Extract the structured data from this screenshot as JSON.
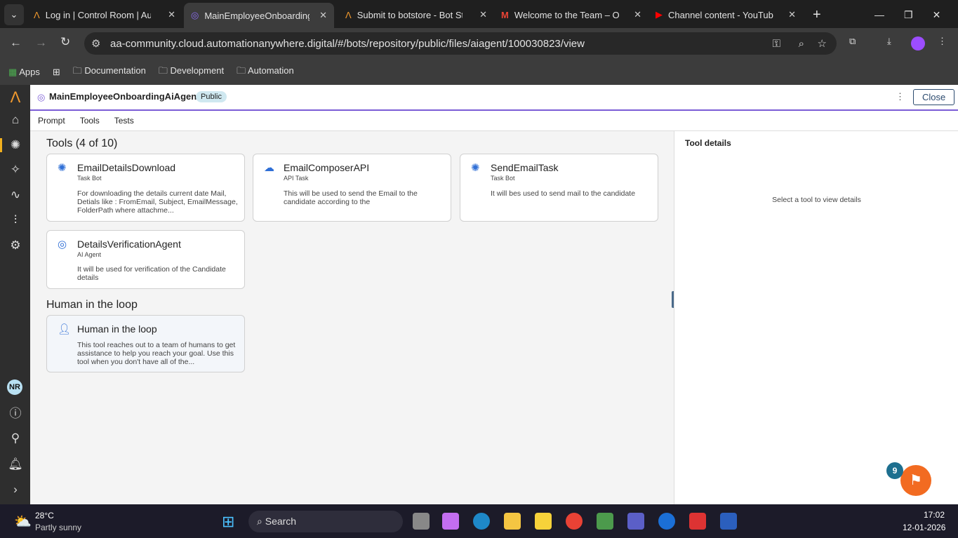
{
  "browser": {
    "tabs": [
      {
        "title": "Log in | Control Room | Automation Anywhere",
        "active": false
      },
      {
        "title": "MainEmployeeOnboardingAiAgent",
        "active": true
      },
      {
        "title": "Submit to botstore - Bot Store",
        "active": false
      },
      {
        "title": "Welcome to the Team – Onboarding",
        "active": false
      },
      {
        "title": "Channel content - YouTube Studio",
        "active": false
      }
    ],
    "url": "aa-community.cloud.automationanywhere.digital/#/bots/repository/public/files/aiagent/100030823/view",
    "bookmarks": [
      "Apps",
      "Documentation",
      "Development",
      "Automation"
    ]
  },
  "header": {
    "title": "MainEmployeeOnboardingAiAgent",
    "badge": "Public",
    "close": "Close"
  },
  "nav": {
    "tabs": [
      "Prompt",
      "Tools",
      "Tests"
    ]
  },
  "tools": {
    "heading": "Tools (4 of 10)",
    "items": [
      {
        "name": "EmailDetailsDownload",
        "type": "Task Bot",
        "icon": "task-bot-icon",
        "desc": "For downloading the details current date Mail, Detials like : FromEmail, Subject, EmailMessage, FolderPath where attachme..."
      },
      {
        "name": "EmailComposerAPI",
        "type": "API Task",
        "icon": "api-task-icon",
        "desc": "This will be used to send the Email to the candidate according to the"
      },
      {
        "name": "SendEmailTask",
        "type": "Task Bot",
        "icon": "task-bot-icon",
        "desc": "It will bes used to send mail to the candidate"
      },
      {
        "name": "DetailsVerificationAgent",
        "type": "AI Agent",
        "icon": "ai-agent-icon",
        "desc": "It will be used for verification of the Candidate details"
      }
    ]
  },
  "hitl": {
    "heading": "Human in the loop",
    "name": "Human in the loop",
    "desc": "This tool reaches out to a team of humans to get assistance to help you reach your goal. Use this tool when you don't have all of the..."
  },
  "details": {
    "title": "Tool details",
    "empty": "Select a tool to view details"
  },
  "user": {
    "initials": "NR"
  },
  "help_badge": "9",
  "taskbar": {
    "temp": "28°C",
    "weather": "Partly sunny",
    "search": "Search",
    "time": "17:02",
    "date": "12-01-2026"
  },
  "colors": {
    "accent": "#7b5cd6",
    "icon_blue": "#2f6fd6",
    "help_orange": "#f26b21"
  }
}
